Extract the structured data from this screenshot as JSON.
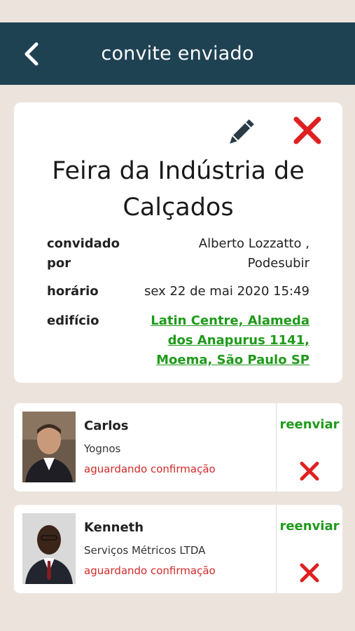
{
  "header": {
    "title": "convite enviado",
    "back_icon": "chevron-left-icon",
    "background": "#1f4253"
  },
  "event": {
    "title": "Feira da Indústria de Calçados",
    "invited_by_label": "convidado por",
    "invited_by_value": "Alberto Lozzatto , Podesubir",
    "time_label": "horário",
    "time_value": "sex 22 de mai 2020 15:49",
    "building_label": "edifício",
    "building_value": "Latin Centre, Alameda dos Anapurus 1141, Moema, São Paulo SP",
    "edit_icon": "pencil-icon",
    "delete_icon": "close-icon"
  },
  "guests": [
    {
      "name": "Carlos",
      "company": "Yognos",
      "status": "aguardando confirmação",
      "resend_label": "reenviar"
    },
    {
      "name": "Kenneth",
      "company": "Serviços Métricos LTDA",
      "status": "aguardando confirmação",
      "resend_label": "reenviar"
    }
  ],
  "colors": {
    "accent_green": "#1f9a1a",
    "status_red": "#d22a2a",
    "delete_red": "#e02020",
    "background": "#ece4dc"
  }
}
